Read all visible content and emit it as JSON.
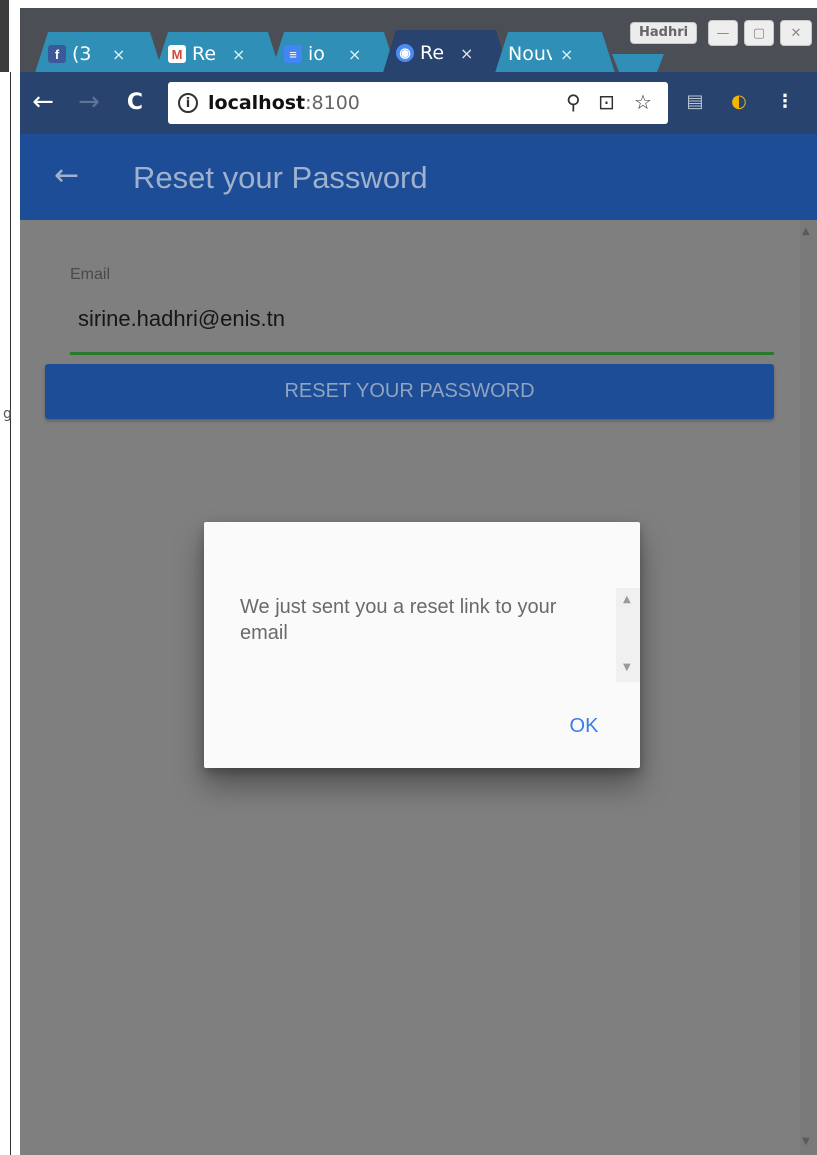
{
  "browser": {
    "tabs": [
      {
        "icon": "f",
        "title": "(3",
        "close": "×",
        "color": "#1f63c8"
      },
      {
        "icon": "M",
        "title": "Re",
        "close": "×",
        "color": "#d14836"
      },
      {
        "icon": "≡",
        "title": "io",
        "close": "×",
        "color": "#4285f4"
      },
      {
        "icon": "◉",
        "title": "Re",
        "close": "×",
        "color": "#4c8bf5",
        "active": true
      },
      {
        "icon": "",
        "title": "Nouv",
        "close": "×"
      }
    ],
    "profile_name": "Hadhri",
    "window_controls": {
      "minimize": "—",
      "maximize": "▢",
      "close": "✕"
    },
    "nav": {
      "back": "←",
      "forward": "→",
      "reload": "C"
    },
    "address": {
      "info_icon": "i",
      "host": "localhost",
      "port": ":8100"
    },
    "omnibox_icons": {
      "key": "⚲",
      "translate": "⊡",
      "star": "☆"
    },
    "extensions": {
      "ext1": "▤",
      "ext2": "◐",
      "menu": "⋮"
    }
  },
  "left_edge_glyph": "g",
  "app": {
    "header": {
      "back": "←",
      "title": "Reset your Password"
    },
    "form": {
      "email_label": "Email",
      "email_value": "sirine.hadhri@enis.tn",
      "submit_label": "RESET YOUR PASSWORD"
    }
  },
  "dialog": {
    "message": "We just sent you a reset link to your email",
    "ok_label": "OK"
  },
  "colors": {
    "header_bg": "#1d4d96",
    "backdrop": "#7f7f7f",
    "accent_link": "#3b7de8",
    "input_underline": "#2a7a2e"
  }
}
